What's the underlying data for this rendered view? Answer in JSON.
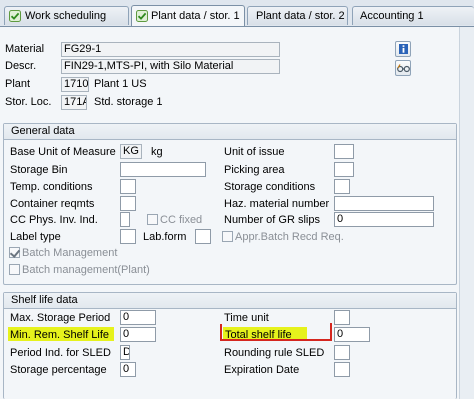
{
  "tabs": [
    {
      "label": "Work scheduling",
      "active": false,
      "has_icon": true
    },
    {
      "label": "Plant data / stor. 1",
      "active": true,
      "has_icon": true
    },
    {
      "label": "Plant data / stor. 2",
      "active": false,
      "has_icon": false
    },
    {
      "label": "Accounting 1",
      "active": false,
      "has_icon": false
    }
  ],
  "header": {
    "material_label": "Material",
    "material_value": "FG29-1",
    "descr_label": "Descr.",
    "descr_value": "FIN29-1,MTS-PI, with Silo Material",
    "plant_label": "Plant",
    "plant_value": "1710",
    "plant_text": "Plant 1 US",
    "stor_label": "Stor. Loc.",
    "stor_value": "171A",
    "stor_text": "Std. storage 1",
    "info_icon": "info-icon",
    "glasses_icon": "glasses-icon"
  },
  "general": {
    "title": "General data",
    "base_uom_label": "Base Unit of Measure",
    "base_uom_value": "KG",
    "base_uom_text": "kg",
    "unit_issue_label": "Unit of issue",
    "unit_issue_value": "",
    "storage_bin_label": "Storage Bin",
    "storage_bin_value": "",
    "picking_area_label": "Picking area",
    "picking_area_value": "",
    "temp_label": "Temp. conditions",
    "temp_value": "",
    "storage_cond_label": "Storage conditions",
    "storage_cond_value": "",
    "container_label": "Container reqmts",
    "container_value": "",
    "haz_label": "Haz. material number",
    "haz_value": "",
    "cc_phys_label": "CC Phys. Inv. Ind.",
    "cc_phys_value": "",
    "cc_fixed_label": "CC fixed",
    "num_gr_label": "Number of GR slips",
    "num_gr_value": "0",
    "label_type_label": "Label type",
    "label_type_value": "",
    "lab_form_label": "Lab.form",
    "lab_form_value": "",
    "appr_batch_label": "Appr.Batch Recd Req.",
    "batch_mgmt_label": "Batch Management",
    "batch_mgmt_checked": true,
    "batch_mgmt_plant_label": "Batch management(Plant)",
    "batch_mgmt_plant_checked": false
  },
  "shelf": {
    "title": "Shelf life data",
    "max_storage_label": "Max. Storage Period",
    "max_storage_value": "0",
    "time_unit_label": "Time unit",
    "time_unit_value": "",
    "min_rem_label": "Min. Rem. Shelf Life",
    "min_rem_value": "0",
    "total_shelf_label": "Total shelf life",
    "total_shelf_value": "0",
    "period_ind_label": "Period Ind. for SLED",
    "period_ind_value": "D",
    "rounding_label": "Rounding rule SLED",
    "rounding_value": "",
    "storage_pct_label": "Storage percentage",
    "storage_pct_value": "0",
    "expiration_label": "Expiration Date",
    "expiration_value": ""
  },
  "colors": {
    "highlight": "#e6f21c",
    "red_marker": "#d5261f"
  }
}
